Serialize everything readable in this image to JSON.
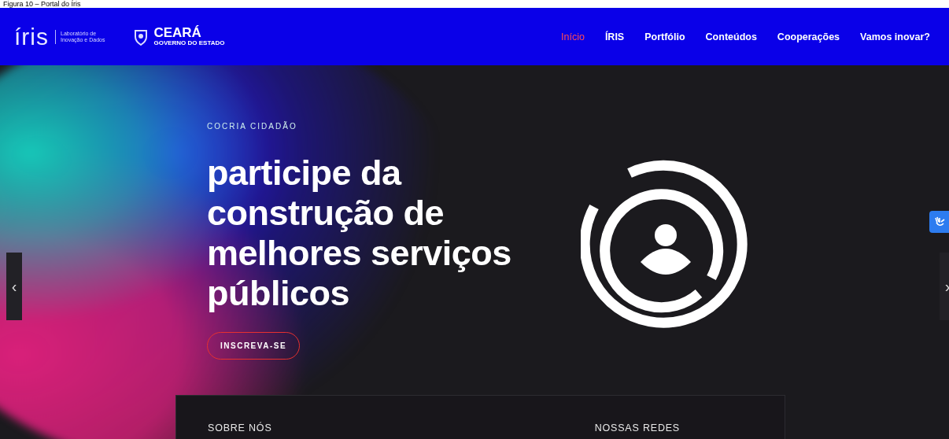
{
  "caption": "Figura 10 – Portal do Íris",
  "header": {
    "logo": "íris",
    "logo_subtitle": [
      "Laboratório de",
      "Inovação e Dados"
    ],
    "partner": "CEARÁ",
    "partner_subtitle": "GOVERNO DO ESTADO",
    "nav": [
      {
        "label": "Início",
        "selected": true
      },
      {
        "label": "ÍRIS",
        "selected": false
      },
      {
        "label": "Portfólio",
        "selected": false
      },
      {
        "label": "Conteúdos",
        "selected": false
      },
      {
        "label": "Cooperações",
        "selected": false
      },
      {
        "label": "Vamos inovar?",
        "selected": false
      }
    ]
  },
  "hero": {
    "eyebrow": "COCRIA CIDADÃO",
    "title": [
      "participe da",
      "construção de",
      "melhores serviços",
      "públicos"
    ],
    "button": "INSCREVA-SE",
    "prev": "‹",
    "next": "›"
  },
  "footer_card": {
    "headings": [
      "SOBRE NÓS",
      "NOSSAS REDES"
    ]
  }
}
